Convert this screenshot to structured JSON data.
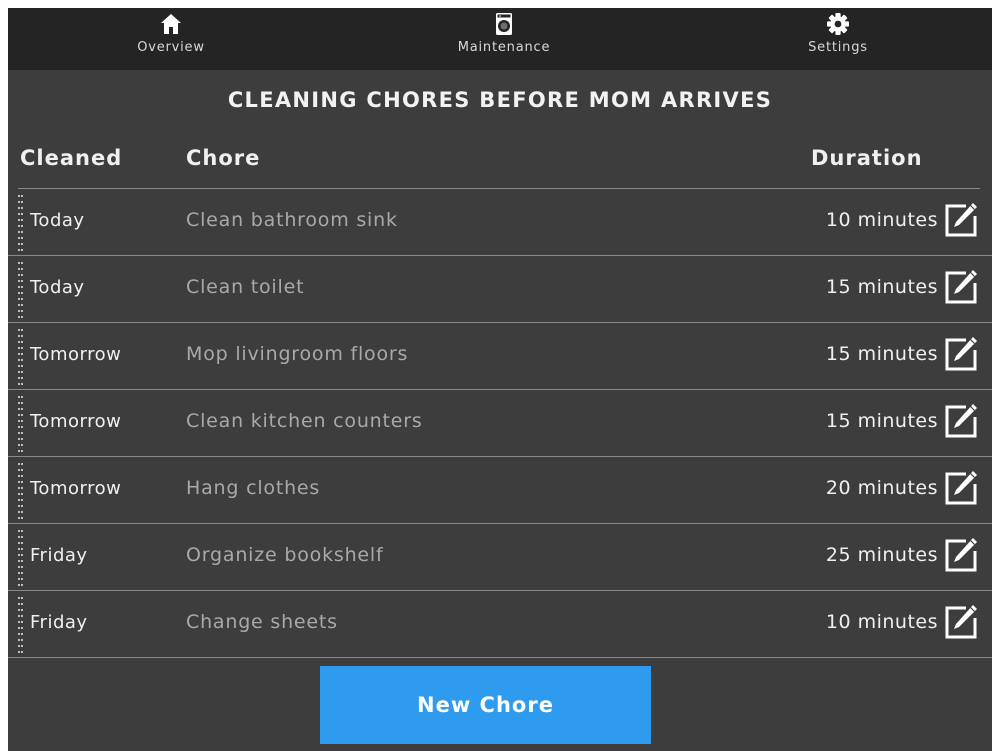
{
  "nav": {
    "items": [
      {
        "label": "Overview",
        "icon": "home-icon"
      },
      {
        "label": "Maintenance",
        "icon": "washing-machine-icon"
      },
      {
        "label": "Settings",
        "icon": "gear-icon"
      }
    ]
  },
  "page": {
    "title": "CLEANING CHORES BEFORE MOM ARRIVES"
  },
  "table": {
    "headers": {
      "cleaned": "Cleaned",
      "chore": "Chore",
      "duration": "Duration"
    },
    "rows": [
      {
        "cleaned": "Today",
        "chore": "Clean bathroom sink",
        "duration": "10 minutes"
      },
      {
        "cleaned": "Today",
        "chore": "Clean toilet",
        "duration": "15 minutes"
      },
      {
        "cleaned": "Tomorrow",
        "chore": "Mop livingroom floors",
        "duration": "15 minutes"
      },
      {
        "cleaned": "Tomorrow",
        "chore": "Clean kitchen counters",
        "duration": "15 minutes"
      },
      {
        "cleaned": "Tomorrow",
        "chore": "Hang clothes",
        "duration": "20 minutes"
      },
      {
        "cleaned": "Friday",
        "chore": "Organize bookshelf",
        "duration": "25 minutes"
      },
      {
        "cleaned": "Friday",
        "chore": "Change sheets",
        "duration": "10 minutes"
      }
    ]
  },
  "actions": {
    "new_chore_label": "New Chore"
  },
  "colors": {
    "background": "#3d3d3d",
    "navbar": "#242424",
    "accent": "#2e9bef",
    "muted_text": "#a9a9a9"
  }
}
